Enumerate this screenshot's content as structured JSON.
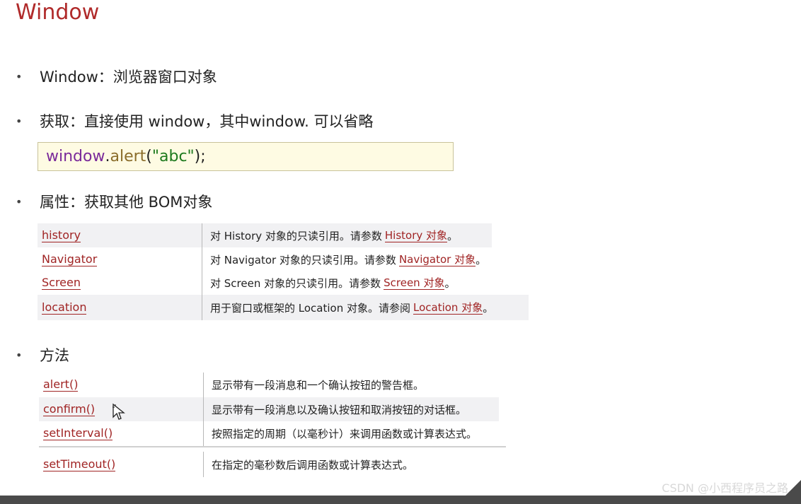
{
  "title": "Window",
  "bullets": {
    "b1": "Window：浏览器窗口对象",
    "b2": "获取：直接使用 window，其中window. 可以省略",
    "b3": "属性：获取其他 BOM对象",
    "b4": "方法"
  },
  "code": {
    "obj": "window",
    "dot": ".",
    "method": "alert",
    "open": "(",
    "string": "\"abc\"",
    "close": ");"
  },
  "properties": [
    {
      "name": "history",
      "desc": "对 History 对象的只读引用。请参数",
      "link": "History 对象",
      "tail": "。"
    },
    {
      "name": "Navigator",
      "desc": "对 Navigator 对象的只读引用。请参数",
      "link": "Navigator 对象",
      "tail": "。"
    },
    {
      "name": "Screen",
      "desc": "对 Screen 对象的只读引用。请参数",
      "link": "Screen 对象",
      "tail": "。"
    },
    {
      "name": "location",
      "desc": "用于窗口或框架的 Location 对象。请参阅",
      "link": "Location 对象",
      "tail": "。"
    }
  ],
  "methods": [
    {
      "name": "alert()",
      "desc": "显示带有一段消息和一个确认按钮的警告框。"
    },
    {
      "name": "confirm()",
      "desc": "显示带有一段消息以及确认按钮和取消按钮的对话框。"
    },
    {
      "name": "setInterval()",
      "desc": "按照指定的周期（以毫秒计）来调用函数或计算表达式。"
    },
    {
      "name": "setTimeout()",
      "desc": "在指定的毫秒数后调用函数或计算表达式。"
    }
  ],
  "watermark": "CSDN @小西程序员之路",
  "icons": {
    "cursor": "mouse-pointer-icon"
  }
}
